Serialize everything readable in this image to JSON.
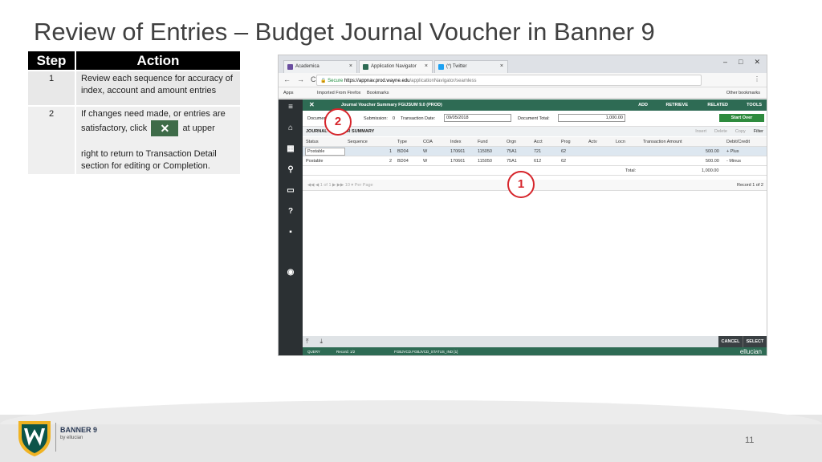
{
  "slide": {
    "title": "Review of Entries – Budget Journal Voucher in Banner 9",
    "page_number": "11"
  },
  "steps_table": {
    "header_step": "Step",
    "header_action": "Action",
    "rows": [
      {
        "step": "1",
        "action": "Review each sequence for accuracy of index, account and amount entries"
      },
      {
        "step": "2",
        "action_before": "If changes need made, or entries are satisfactory, click",
        "action_icon": "✕",
        "action_after": "at upper",
        "action_cont": "right to return to Transaction Detail section for editing or Completion."
      }
    ]
  },
  "browser": {
    "tabs": [
      {
        "label": "Academica",
        "fav_color": "#6a4ea0"
      },
      {
        "label": "Application Navigator",
        "fav_color": "#2e6b54"
      },
      {
        "label": "(*) Twitter",
        "fav_color": "#1da1f2"
      }
    ],
    "url_secure": "Secure",
    "url_host": "https://appnav.prod.wayne.edu",
    "url_path": "/applicationNavigator/seamless",
    "bookmarks": [
      "Apps",
      "Imported From Firefox",
      "Bookmarks"
    ],
    "other_bookmarks": "Other bookmarks"
  },
  "banner_app": {
    "close_icon": "✕",
    "title": "Journal Voucher Summary FGIJSUM 9.0 (PROD)",
    "top_actions": [
      "ADD",
      "RETRIEVE",
      "RELATED",
      "TOOLS"
    ],
    "key_fields": {
      "document_label": "Document:",
      "submission_label": "Submission:",
      "submission_value": "0",
      "transaction_date_label": "Transaction Date:",
      "transaction_date_value": "09/05/2018",
      "document_total_label": "Document Total:",
      "document_total_value": "1,000.00"
    },
    "start_over": "Start Over",
    "section_label": "JOURNAL VOUCHER SUMMARY",
    "section_ops": [
      "Insert",
      "Delete",
      "Copy",
      "Filter"
    ],
    "columns": [
      "Status",
      "Sequence",
      "Type",
      "COA",
      "Index",
      "Fund",
      "Orgn",
      "Acct",
      "Prog",
      "Actv",
      "Locn",
      "Transaction Amount",
      "Debit/Credit"
    ],
    "rows": [
      {
        "status": "Postable",
        "sequence": "1",
        "type": "BD04",
        "coa": "W",
        "index": "170661",
        "fund": "115050",
        "orgn": "75A1",
        "acct": "721",
        "prog": "62",
        "actv": "",
        "locn": "",
        "amount": "500.00",
        "dc": "+ Plus"
      },
      {
        "status": "Postable",
        "sequence": "2",
        "type": "BD04",
        "coa": "W",
        "index": "170661",
        "fund": "115050",
        "orgn": "75A1",
        "acct": "612",
        "prog": "62",
        "actv": "",
        "locn": "",
        "amount": "500.00",
        "dc": "- Minus"
      }
    ],
    "total_label": "Total:",
    "total_value": "1,000.00",
    "pager": "◀◀  ◀  1  of 1  ▶  ▶▶      10  ▾  Per Page",
    "record": "Record 1 of 2",
    "cancel": "CANCEL",
    "select": "SELECT",
    "status_query": "QUERY",
    "status_record": "Record: 1/2",
    "status_field": "FGBJVCD.FGBJVCD_STATUS_IND [1]",
    "brand": "ellucian"
  },
  "callouts": [
    "1",
    "2"
  ],
  "footer": {
    "banner_label": "BANNER 9",
    "by_label": "by ellucian"
  },
  "colors": {
    "banner_green": "#2e6b54",
    "callout_red": "#d6252b",
    "nav_dark": "#2b3033"
  }
}
